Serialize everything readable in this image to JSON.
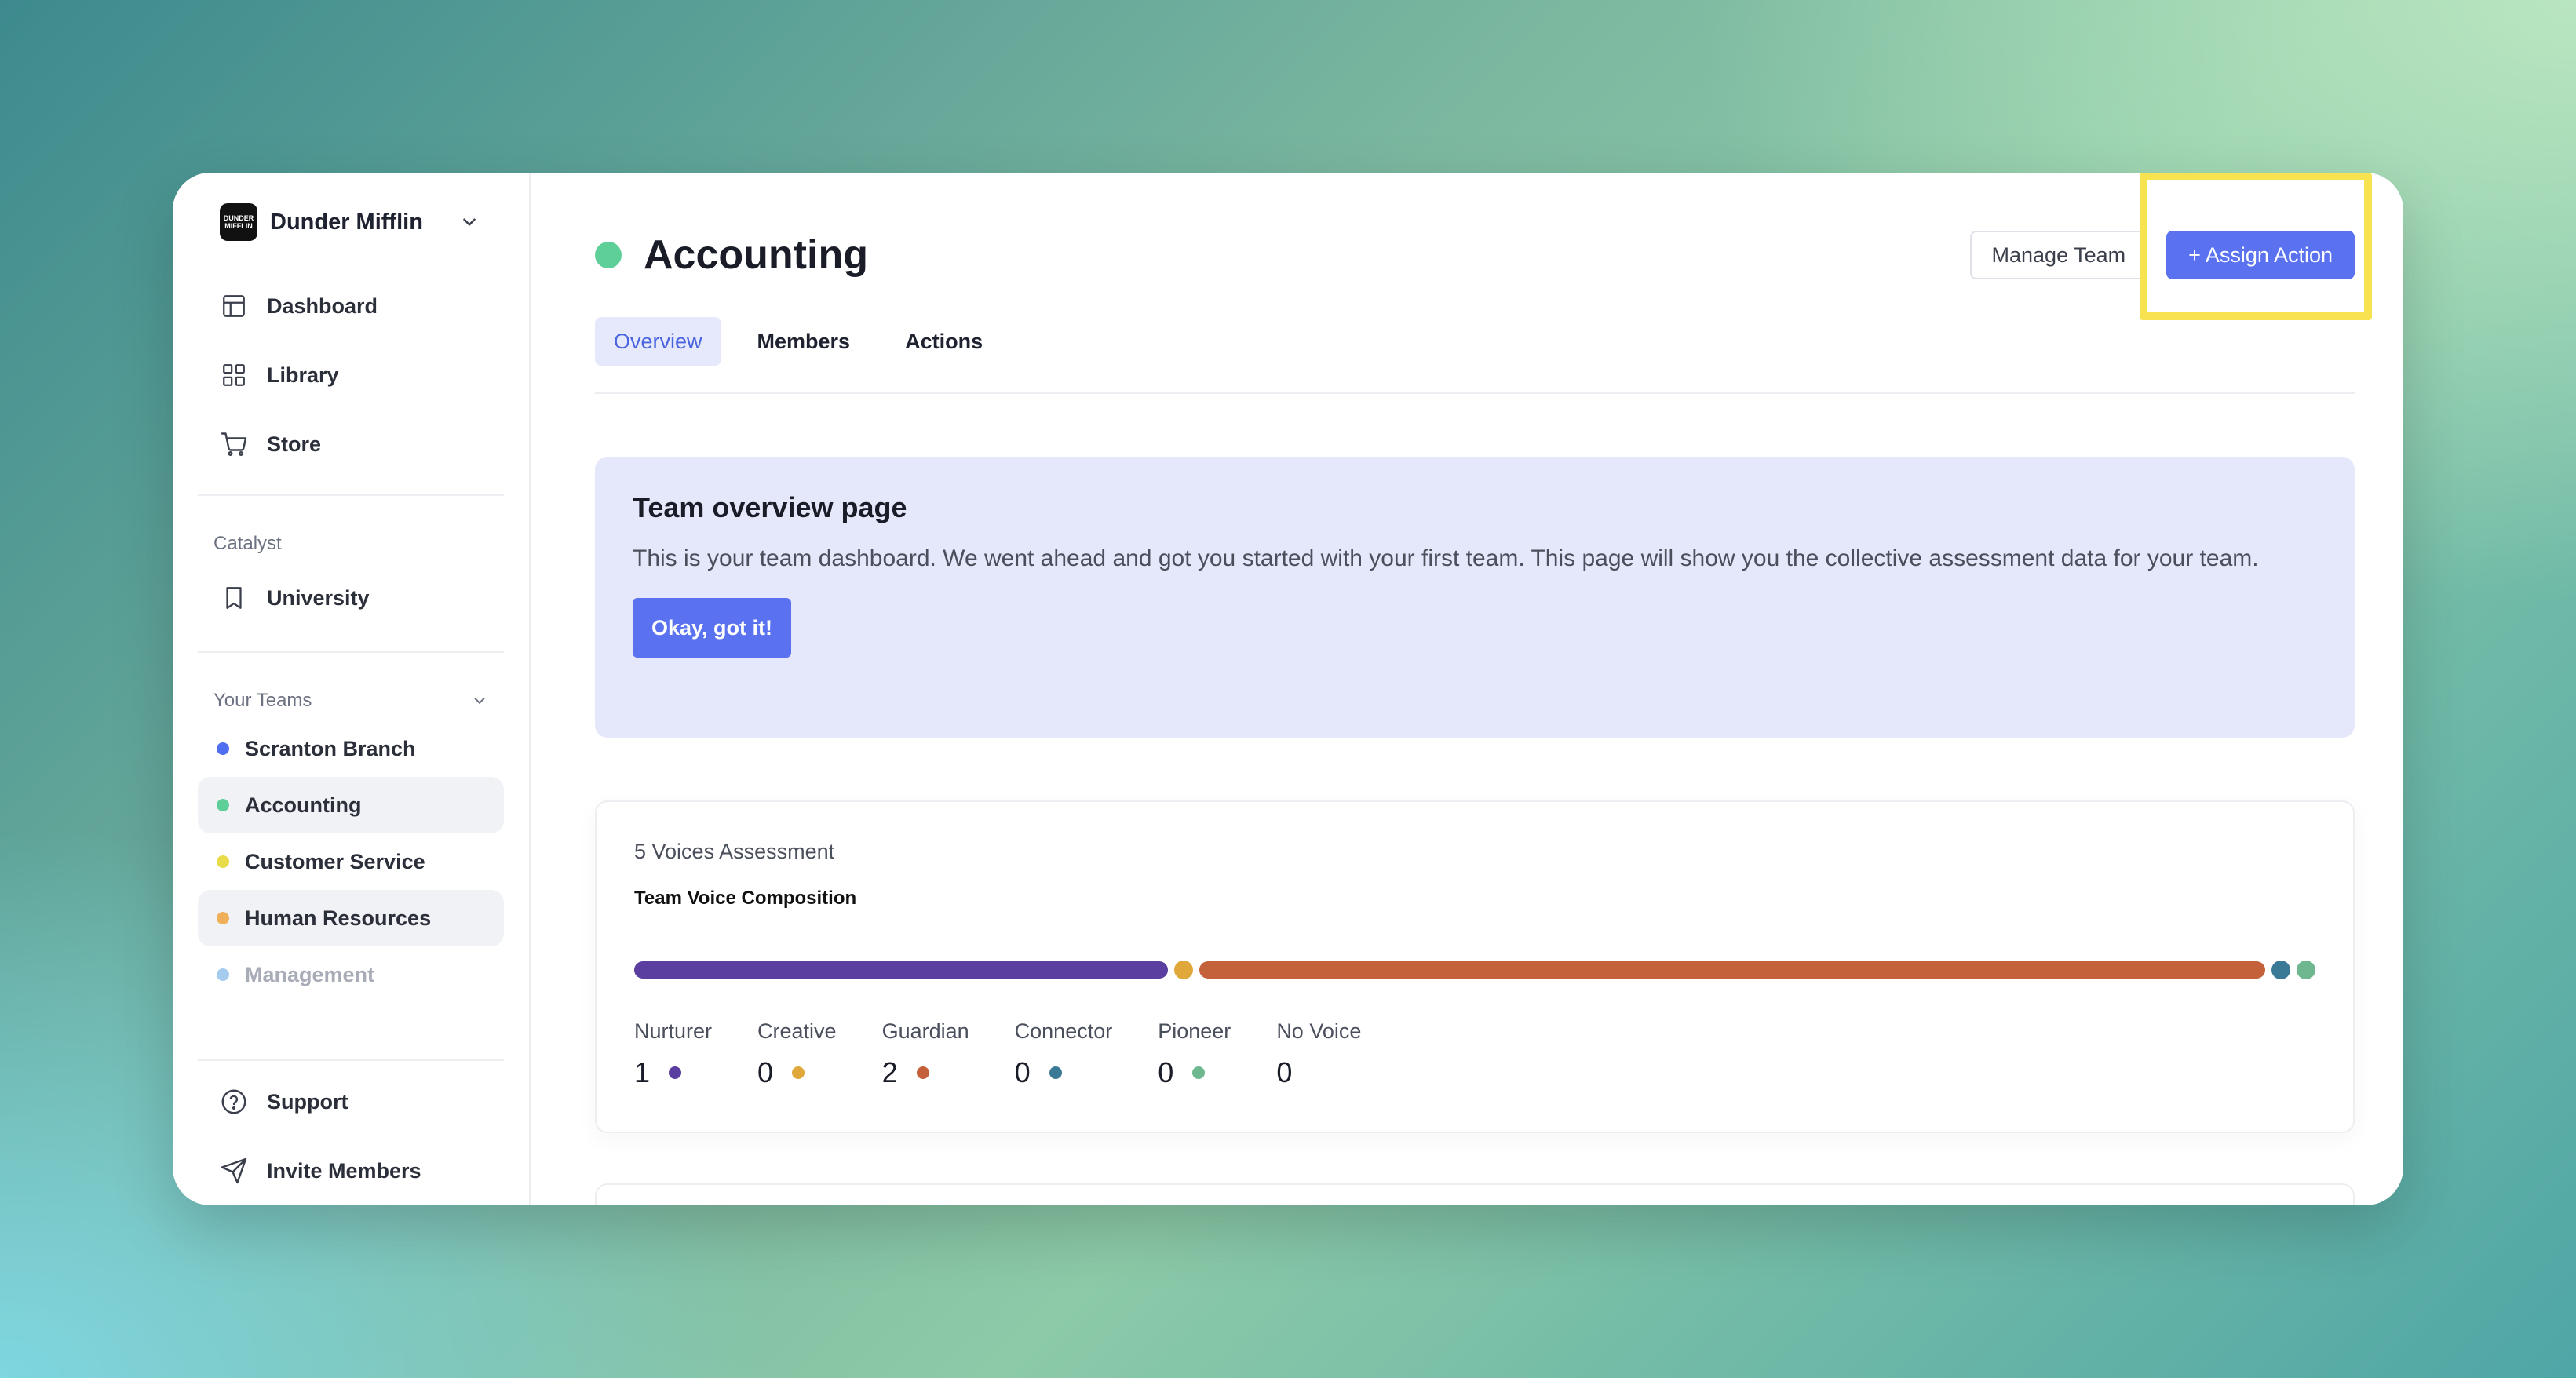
{
  "org": {
    "logo_text": "DUNDER MIFFLIN",
    "name": "Dunder Mifflin"
  },
  "nav": [
    {
      "label": "Dashboard",
      "icon": "dashboard-icon"
    },
    {
      "label": "Library",
      "icon": "grid-icon"
    },
    {
      "label": "Store",
      "icon": "cart-icon"
    }
  ],
  "catalyst": {
    "label": "Catalyst",
    "items": [
      {
        "label": "University",
        "icon": "bookmark-icon"
      }
    ]
  },
  "teams": {
    "label": "Your Teams",
    "items": [
      {
        "label": "Scranton Branch",
        "color": "#4f6ef0"
      },
      {
        "label": "Accounting",
        "color": "#5fcf9a"
      },
      {
        "label": "Customer Service",
        "color": "#e9dc4a"
      },
      {
        "label": "Human Resources",
        "color": "#f0b05a"
      },
      {
        "label": "Management",
        "color": "#7fb6e8"
      }
    ]
  },
  "bottom_nav": [
    {
      "label": "Support",
      "icon": "help-circle-icon"
    },
    {
      "label": "Invite Members",
      "icon": "send-icon"
    }
  ],
  "header": {
    "title": "Accounting",
    "status_color": "#5fcf9a",
    "manage_label": "Manage Team",
    "assign_label": "+ Assign Action"
  },
  "tabs": [
    {
      "label": "Overview",
      "active": true
    },
    {
      "label": "Members"
    },
    {
      "label": "Actions"
    }
  ],
  "banner": {
    "title": "Team overview page",
    "body": "This is your team dashboard. We went ahead and got you started with your first team. This page will show you the collective assessment data for your team.",
    "button": "Okay, got it!"
  },
  "assessment": {
    "title": "5 Voices Assessment",
    "subtitle": "Team Voice Composition",
    "voices": [
      {
        "name": "Nurturer",
        "value": "1",
        "color": "#5b3fa0"
      },
      {
        "name": "Creative",
        "value": "0",
        "color": "#e0a83a"
      },
      {
        "name": "Guardian",
        "value": "2",
        "color": "#c4613a"
      },
      {
        "name": "Connector",
        "value": "0",
        "color": "#3b7a96"
      },
      {
        "name": "Pioneer",
        "value": "0",
        "color": "#6fb88f"
      },
      {
        "name": "No Voice",
        "value": "0",
        "color": ""
      }
    ]
  }
}
